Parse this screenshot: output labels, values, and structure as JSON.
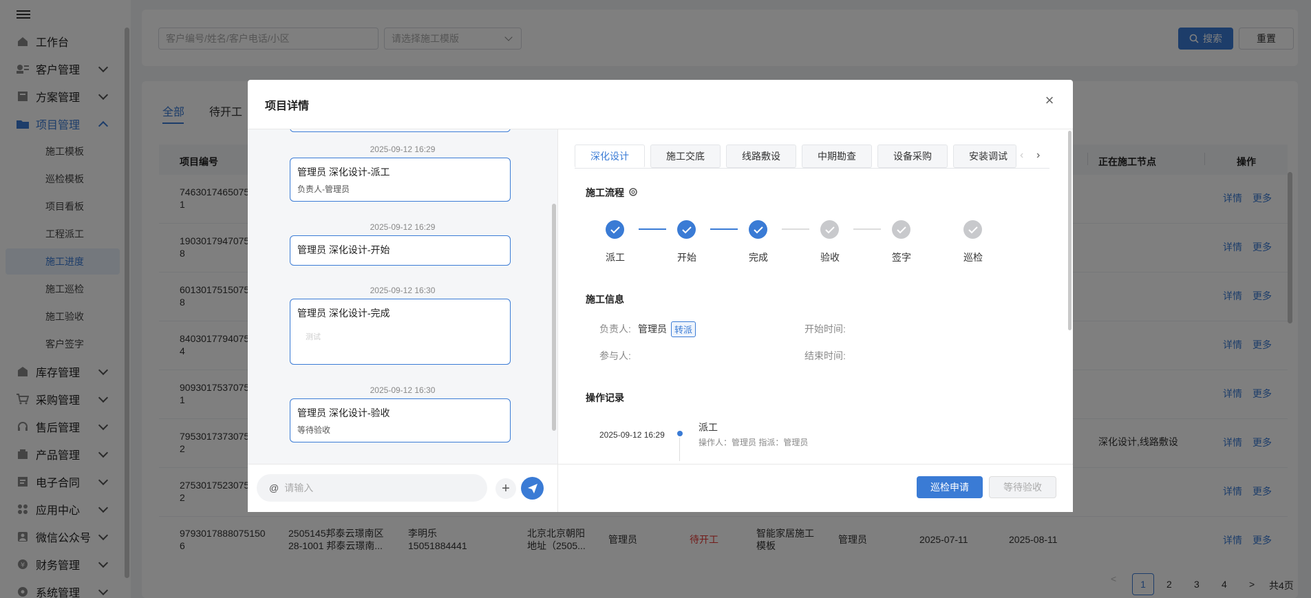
{
  "sidebar": {
    "items": [
      {
        "label": "工作台",
        "icon": "home-icon"
      },
      {
        "label": "客户管理",
        "icon": "customer-icon"
      },
      {
        "label": "方案管理",
        "icon": "plan-icon"
      },
      {
        "label": "项目管理",
        "icon": "folder-icon"
      },
      {
        "label": "库存管理",
        "icon": "warehouse-icon"
      },
      {
        "label": "采购管理",
        "icon": "cart-icon"
      },
      {
        "label": "售后管理",
        "icon": "headset-icon"
      },
      {
        "label": "产品管理",
        "icon": "product-icon"
      },
      {
        "label": "电子合同",
        "icon": "contract-icon"
      },
      {
        "label": "应用中心",
        "icon": "apps-icon"
      },
      {
        "label": "微信公众号",
        "icon": "wechat-icon"
      },
      {
        "label": "财务管理",
        "icon": "finance-icon"
      },
      {
        "label": "系统管理",
        "icon": "settings-icon"
      }
    ],
    "sub_items": [
      "施工模板",
      "巡检模板",
      "项目看板",
      "工程派工",
      "施工进度",
      "施工巡检",
      "施工验收",
      "客户签字"
    ]
  },
  "search": {
    "keyword_placeholder": "客户编号/姓名/客户电话/小区",
    "template_placeholder": "请选择施工模版",
    "search_label": "搜索",
    "reset_label": "重置"
  },
  "list": {
    "tabs": [
      "全部",
      "待开工"
    ],
    "headers": {
      "project_no": "项目编号",
      "current_node": "正在施工节点",
      "actions": "操作"
    },
    "rows": [
      {
        "no1": "7463017465075",
        "no2": "1",
        "node": ""
      },
      {
        "no1": "1903017947075",
        "no2": "8",
        "node": ""
      },
      {
        "no1": "6013017515075",
        "no2": "8",
        "node": ""
      },
      {
        "no1": "8403017794075",
        "no2": "4",
        "node": ""
      },
      {
        "no1": "9093017537075",
        "no2": "1",
        "node": ""
      },
      {
        "no1": "7953017373075",
        "no2": "2",
        "node": "深化设计,线路敷设"
      },
      {
        "no1": "2753017523075",
        "no2": "2",
        "node": ""
      }
    ],
    "last_row": {
      "no1": "9793017888075150",
      "no2": "6",
      "community1": "2505145邦泰云璟南区",
      "community2": "28-1001 邦泰云璟南...",
      "customer": "李明乐",
      "phone": "15051884441",
      "addr1": "北京北京朝阳",
      "addr2": "地址（2505...",
      "manager": "管理员",
      "status": "待开工",
      "template1": "智能家居施工",
      "template2": "模板",
      "owner": "管理员",
      "start": "2025-07-11",
      "end": "2025-08-11"
    },
    "detail_label": "详情",
    "more_label": "更多",
    "pagination": {
      "pages": [
        "1",
        "2",
        "3",
        "4"
      ],
      "current": "1",
      "total": "共4页"
    }
  },
  "modal": {
    "title": "项目详情",
    "chat": {
      "messages": [
        {
          "time": "2025-09-12 16:29",
          "title": "管理员 深化设计-派工",
          "sub": "负责人-管理员"
        },
        {
          "time": "2025-09-12 16:29",
          "title": "管理员 深化设计-开始",
          "sub": ""
        },
        {
          "time": "2025-09-12 16:30",
          "title": "管理员 深化设计-完成",
          "sub": "",
          "faint": "测试"
        },
        {
          "time": "2025-09-12 16:30",
          "title": "管理员 深化设计-验收",
          "sub": "等待验收"
        }
      ],
      "input_placeholder": "请输入",
      "at_symbol": "@"
    },
    "tabs": [
      "深化设计",
      "施工交底",
      "线路敷设",
      "中期勘查",
      "设备采购",
      "安装调试"
    ],
    "flow_title": "施工流程",
    "steps": [
      {
        "label": "派工",
        "done": true
      },
      {
        "label": "开始",
        "done": true
      },
      {
        "label": "完成",
        "done": true
      },
      {
        "label": "验收",
        "done": false
      },
      {
        "label": "签字",
        "done": false
      },
      {
        "label": "巡检",
        "done": false
      }
    ],
    "info_title": "施工信息",
    "info": {
      "owner_label": "负责人:",
      "owner_value": "管理员",
      "reassign_tag": "转派",
      "start_label": "开始时间:",
      "participants_label": "参与人:",
      "end_label": "结束时间:"
    },
    "log_title": "操作记录",
    "log": [
      {
        "time": "2025-09-12 16:29",
        "action": "派工",
        "detail": "操作人：管理员  指派：管理员"
      }
    ],
    "buttons": {
      "inspect": "巡检申请",
      "await": "等待验收"
    },
    "colors": {
      "primary": "#3a7bd5",
      "disabled": "#c8c9cc"
    }
  }
}
